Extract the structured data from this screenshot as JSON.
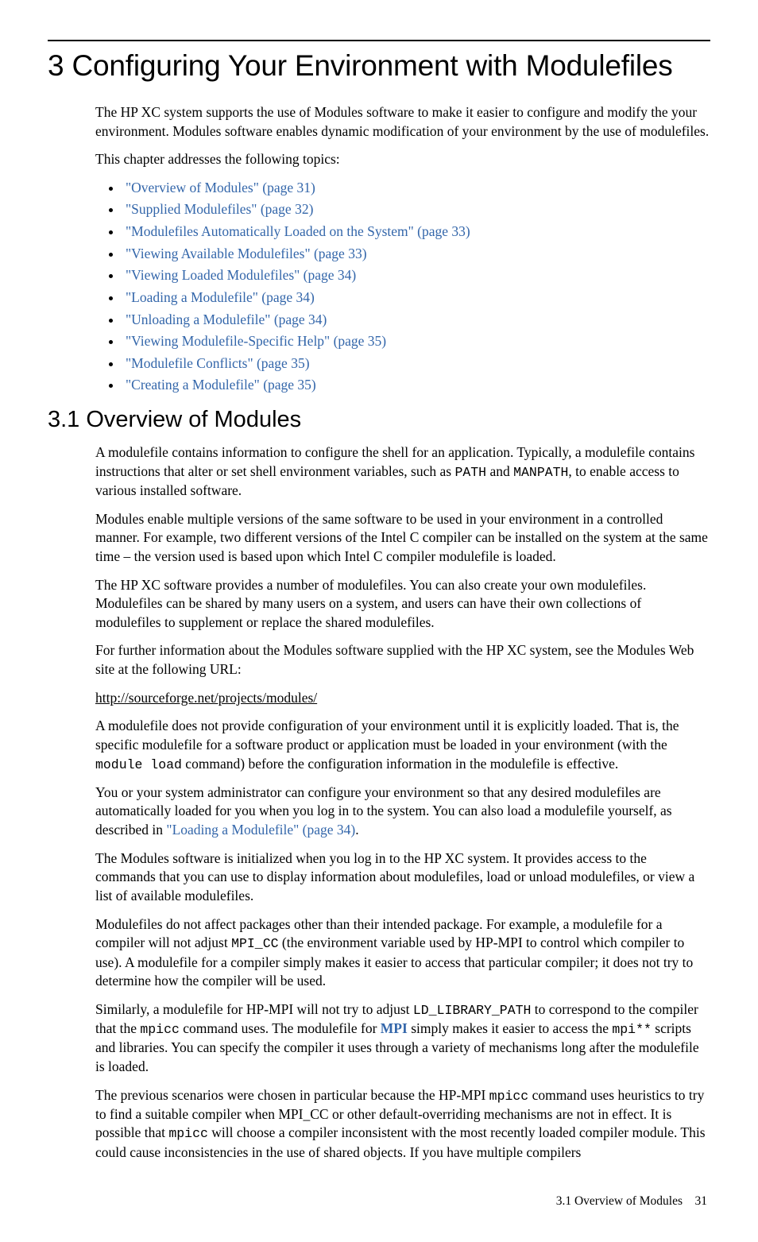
{
  "chapter": {
    "title": "3 Configuring Your Environment with Modulefiles"
  },
  "intro": {
    "p1": "The HP XC system supports the use of Modules software to make it easier to configure and modify the your environment. Modules software enables dynamic modification of your environment by the use of modulefiles.",
    "p2": "This chapter addresses the following topics:"
  },
  "toc": [
    "\"Overview of Modules\" (page 31)",
    "\"Supplied Modulefiles\" (page 32)",
    "\"Modulefiles Automatically Loaded on the System\" (page 33)",
    "\"Viewing Available Modulefiles\" (page 33)",
    "\"Viewing Loaded Modulefiles\" (page 34)",
    "\"Loading a Modulefile\" (page 34)",
    "\"Unloading a Modulefile\" (page 34)",
    "\"Viewing Modulefile-Specific Help\" (page 35)",
    "\"Modulefile Conflicts\" (page 35)",
    "\"Creating a Modulefile\" (page 35)"
  ],
  "section": {
    "title": "3.1 Overview of Modules",
    "p1a": "A modulefile contains information to configure the shell for an application. Typically, a modulefile contains instructions that alter or set shell environment variables, such as ",
    "p1_code1": "PATH",
    "p1b": " and ",
    "p1_code2": "MANPATH",
    "p1c": ", to enable access to various installed software.",
    "p2": "Modules enable multiple versions of the same software to be used in your environment in a controlled manner. For example, two different versions of the Intel C compiler can be installed on the system at the same time – the version used is based upon which Intel C compiler modulefile is loaded.",
    "p3": "The HP XC software provides a number of modulefiles. You can also create your own modulefiles. Modulefiles can be shared by many users on a system, and users can have their own collections of modulefiles to supplement or replace the shared modulefiles.",
    "p4": "For further information about the Modules software supplied with the HP XC system, see the Modules Web site at the following URL:",
    "url": "http://sourceforge.net/projects/modules/",
    "p5a": "A modulefile does not provide configuration of your environment until it is explicitly loaded. That is, the specific modulefile for a software product or application must be loaded in your environment (with the ",
    "p5_code": "module load",
    "p5b": " command) before the configuration information in the modulefile is effective.",
    "p6a": "You or your system administrator can configure your environment so that any desired modulefiles are automatically loaded for you when you log in to the system. You can also load a modulefile yourself, as described in ",
    "p6_link": "\"Loading a Modulefile\" (page 34)",
    "p6b": ".",
    "p7": "The Modules software is initialized when you log in to the HP XC system. It provides access to the commands that you can use to display information about modulefiles, load or unload modulefiles, or view a list of available modulefiles.",
    "p8a": "Modulefiles do not affect packages other than their intended package. For example, a modulefile for a compiler will not adjust ",
    "p8_code": "MPI_CC",
    "p8b": " (the environment variable used by HP-MPI to control which compiler to use). A modulefile for a compiler simply makes it easier to access that particular compiler; it does not try to determine how the compiler will be used.",
    "p9a": "Similarly, a modulefile for HP-MPI will not try to adjust ",
    "p9_code1": "LD_LIBRARY_PATH",
    "p9b": " to correspond to the compiler that the ",
    "p9_code2": "mpicc",
    "p9c": " command uses. The modulefile for ",
    "p9_link": "MPI",
    "p9d": " simply makes it easier to access the ",
    "p9_code3": "mpi**",
    "p9e": " scripts and libraries. You can specify the compiler it uses through a variety of mechanisms long after the modulefile is loaded.",
    "p10a": "The previous scenarios were chosen in particular because the HP-MPI ",
    "p10_code1": "mpicc",
    "p10b": " command uses heuristics to try to find a suitable compiler when MPI_CC or other default-overriding mechanisms are not in effect. It is possible that ",
    "p10_code2": "mpicc",
    "p10c": " will choose a compiler inconsistent with the most recently loaded compiler module. This could cause inconsistencies in the use of shared objects. If you have multiple compilers"
  },
  "footer": {
    "label": "3.1 Overview of Modules",
    "page": "31"
  }
}
